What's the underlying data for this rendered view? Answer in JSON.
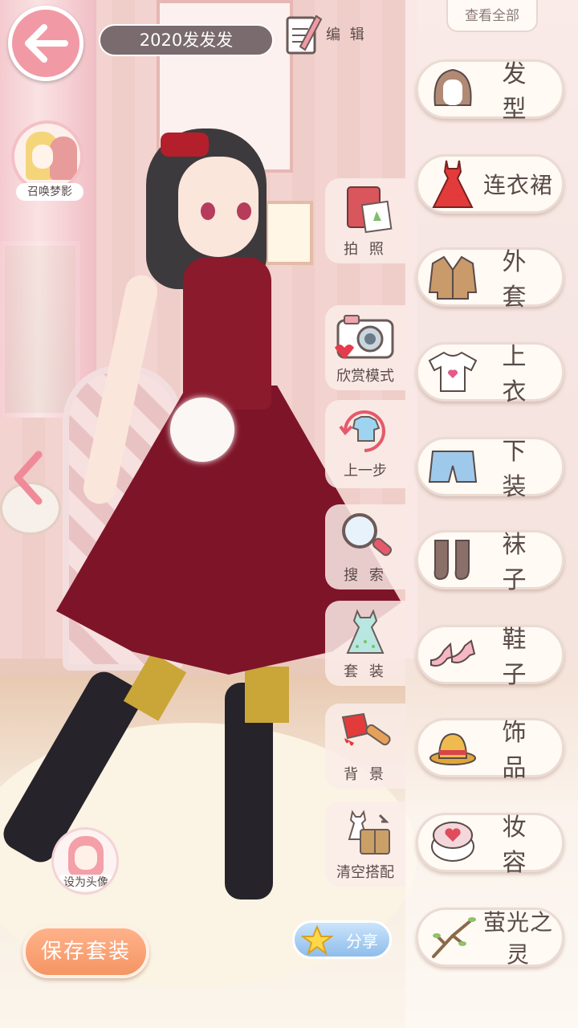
{
  "header": {
    "back_label": "",
    "outfit_name": "2020发发发",
    "edit_label": "编 辑",
    "view_all_label": "查看全部"
  },
  "left": {
    "summon_label": "召唤梦影",
    "set_avatar_label": "设为头像",
    "save_label": "保存套装"
  },
  "tools": [
    {
      "label": "拍 照",
      "icon": "photo-album-icon"
    },
    {
      "label": "欣赏模式",
      "icon": "camera-icon"
    },
    {
      "label": "上一步",
      "icon": "undo-shirt-icon"
    },
    {
      "label": "搜 索",
      "icon": "magnifier-icon"
    },
    {
      "label": "套 装",
      "icon": "outfit-set-icon"
    },
    {
      "label": "背 景",
      "icon": "paint-brush-icon"
    },
    {
      "label": "清空搭配",
      "icon": "clear-wardrobe-icon"
    }
  ],
  "share_label": "分享",
  "categories": [
    {
      "label": "发 型",
      "icon": "hairstyle-icon"
    },
    {
      "label": "连衣裙",
      "icon": "dress-icon"
    },
    {
      "label": "外 套",
      "icon": "coat-icon"
    },
    {
      "label": "上 衣",
      "icon": "tshirt-icon"
    },
    {
      "label": "下 装",
      "icon": "shorts-icon"
    },
    {
      "label": "袜 子",
      "icon": "socks-icon"
    },
    {
      "label": "鞋 子",
      "icon": "high-heels-icon"
    },
    {
      "label": "饰 品",
      "icon": "hat-accessory-icon"
    },
    {
      "label": "妆 容",
      "icon": "makeup-compact-icon"
    },
    {
      "label": "萤光之灵",
      "icon": "branch-icon"
    }
  ],
  "colors": {
    "accent_pink": "#f19aa5",
    "save_orange": "#f59564",
    "share_blue": "#8ebdea",
    "dress_red": "#7e1428"
  }
}
